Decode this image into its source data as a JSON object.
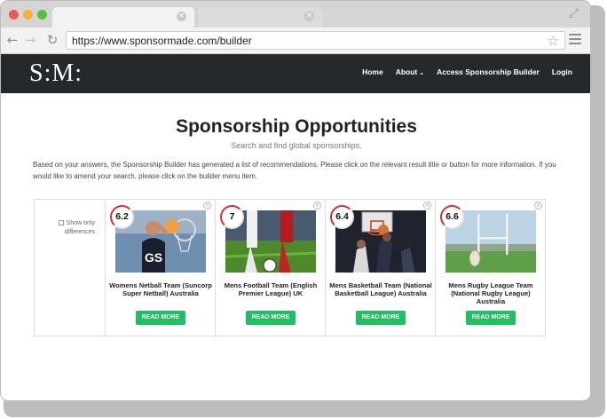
{
  "browser": {
    "url": "https://www.sponsormade.com/builder",
    "tab_close_glyph": "×"
  },
  "site": {
    "logo": "S:M:",
    "nav": [
      {
        "label": "Home"
      },
      {
        "label": "About",
        "has_dropdown": true
      },
      {
        "label": "Access Sponsorship Builder"
      },
      {
        "label": "Login"
      }
    ]
  },
  "page": {
    "title": "Sponsorship Opportunities",
    "subtitle": "Search and find global sponsorships.",
    "intro": "Based on your answers, the Sponsorship Builder has generated a list of recommendations. Please click on the relevant result title or button for more information. If you would like to amend your search, please click on the builder menu item."
  },
  "filters": {
    "show_only_differences": "Show only differences"
  },
  "results": [
    {
      "score": "6.2",
      "title": "Womens Netball Team (Suncorp Super Netball) Australia",
      "button": "READ MORE",
      "image": "netball"
    },
    {
      "score": "7",
      "title": "Mens Football Team (English Premier League) UK",
      "button": "READ MORE",
      "image": "football"
    },
    {
      "score": "6.4",
      "title": "Mens Basketball Team (National Basketball League) Australia",
      "button": "READ MORE",
      "image": "basketball"
    },
    {
      "score": "6.6",
      "title": "Mens Rugby League Team (National Rugby League) Australia",
      "button": "READ MORE",
      "image": "rugby"
    }
  ],
  "colors": {
    "nav_bg": "#25292b",
    "accent_green": "#1fbf62",
    "score_ring": "#d32f2f"
  }
}
